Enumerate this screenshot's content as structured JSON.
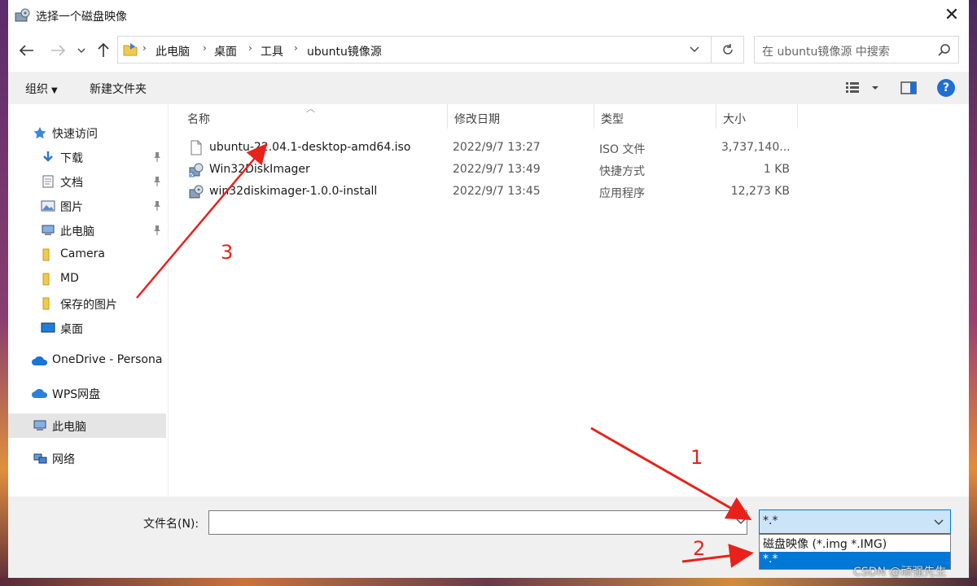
{
  "window": {
    "title": "选择一个磁盘映像"
  },
  "address": {
    "crumbs": [
      "此电脑",
      "桌面",
      "工具",
      "ubuntu镜像源"
    ]
  },
  "search": {
    "placeholder": "在 ubuntu镜像源 中搜索"
  },
  "toolbar": {
    "organize": "组织",
    "new_folder": "新建文件夹"
  },
  "sidebar": {
    "items": [
      {
        "label": "快速访问",
        "icon": "star-icon"
      },
      {
        "label": "下载",
        "icon": "download-icon",
        "pinned": true
      },
      {
        "label": "文档",
        "icon": "document-icon",
        "pinned": true
      },
      {
        "label": "图片",
        "icon": "picture-icon",
        "pinned": true
      },
      {
        "label": "此电脑",
        "icon": "computer-icon",
        "pinned": true
      },
      {
        "label": "Camera",
        "icon": "folder-icon"
      },
      {
        "label": "MD",
        "icon": "folder-icon"
      },
      {
        "label": "保存的图片",
        "icon": "folder-icon"
      },
      {
        "label": "桌面",
        "icon": "desktop-icon"
      },
      {
        "label": "OneDrive - Persona",
        "icon": "cloud-icon"
      },
      {
        "label": "WPS网盘",
        "icon": "cloud-icon"
      },
      {
        "label": "此电脑",
        "icon": "computer-icon",
        "selected": true
      },
      {
        "label": "网络",
        "icon": "network-icon"
      }
    ]
  },
  "columns": {
    "name": "名称",
    "modified": "修改日期",
    "type": "类型",
    "size": "大小"
  },
  "files": [
    {
      "name": "ubuntu-22.04.1-desktop-amd64.iso",
      "modified": "2022/9/7 13:27",
      "type": "ISO 文件",
      "size": "3,737,140..."
    },
    {
      "name": "Win32DiskImager",
      "modified": "2022/9/7 13:49",
      "type": "快捷方式",
      "size": "1 KB"
    },
    {
      "name": "win32diskimager-1.0.0-install",
      "modified": "2022/9/7 13:45",
      "type": "应用程序",
      "size": "12,273 KB"
    }
  ],
  "footer": {
    "filename_label": "文件名(N):",
    "filename_value": "",
    "filetype_selected": "*.*",
    "filetype_options": [
      "磁盘映像 (*.img *.IMG)",
      "*.*"
    ]
  },
  "annotations": {
    "a1": "1",
    "a2": "2",
    "a3": "3"
  },
  "watermark": "CSDN @顽强先生"
}
